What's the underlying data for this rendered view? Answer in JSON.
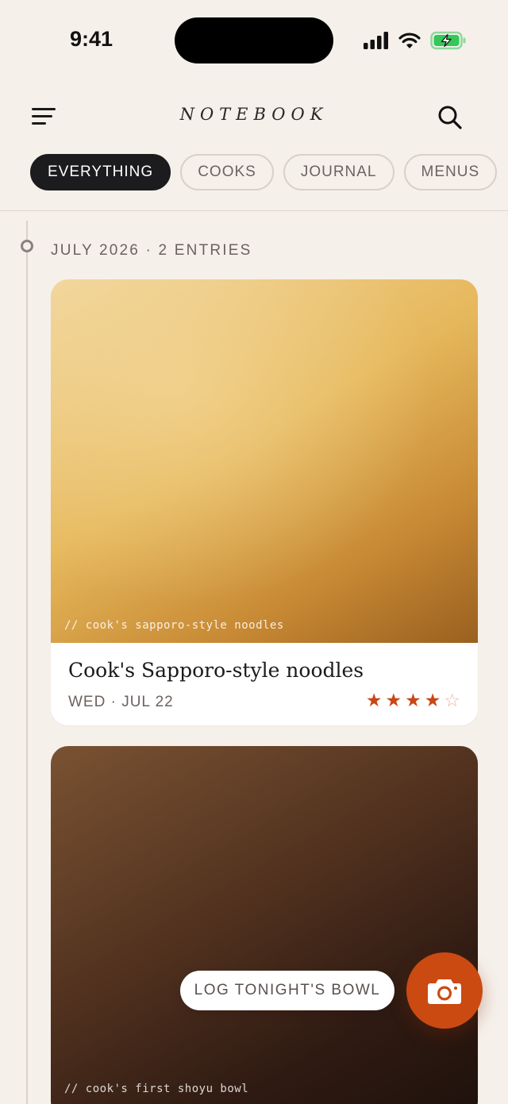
{
  "status_bar": {
    "time": "9:41",
    "battery_color": "#34c759"
  },
  "header": {
    "title": "NOTEBOOK",
    "menu_icon": "hamburger-menu-icon",
    "search_icon": "search-icon"
  },
  "filters": {
    "chips": [
      {
        "label": "EVERYTHING",
        "active": true
      },
      {
        "label": "COOKS",
        "active": false
      },
      {
        "label": "JOURNAL",
        "active": false
      },
      {
        "label": "MENUS",
        "active": false
      }
    ]
  },
  "timeline": {
    "month_heading": "JULY 2026 · 2 ENTRIES",
    "entries": [
      {
        "caption": "// cook's sapporo-style noodles",
        "title": "Cook's Sapporo-style noodles",
        "date": "WED · JUL 22",
        "rating": 4,
        "rating_max": 5,
        "star_filled": "★",
        "star_empty": "☆"
      },
      {
        "caption": "// cook's first shoyu bowl"
      }
    ]
  },
  "actions": {
    "log_label": "LOG TONIGHT'S BOWL",
    "camera_icon": "camera-icon",
    "accent_color": "#cb4a12"
  }
}
